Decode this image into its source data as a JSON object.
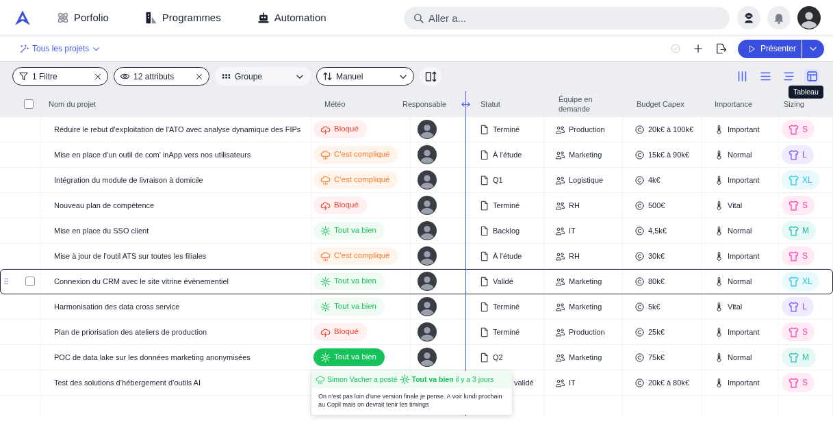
{
  "nav": {
    "items": [
      {
        "label": "Porfolio"
      },
      {
        "label": "Programmes"
      },
      {
        "label": "Automation"
      }
    ],
    "search": {
      "placeholder": "Aller a..."
    }
  },
  "subbar": {
    "scope": "Tous les projets",
    "save_enabled": false,
    "present_button": "Présenter"
  },
  "toolbar": {
    "chips": [
      {
        "kind": "filter",
        "label": "1 Filtre"
      },
      {
        "kind": "attributes",
        "label": "12 attributs"
      },
      {
        "kind": "group",
        "label": "Groupe"
      },
      {
        "kind": "sort",
        "label": "Manuel"
      }
    ],
    "views": [
      {
        "kind": "columns",
        "selected": false
      },
      {
        "kind": "list",
        "selected": false
      },
      {
        "kind": "compact",
        "selected": false
      },
      {
        "kind": "table",
        "selected": true
      }
    ],
    "view_tooltip": "Tableau"
  },
  "table": {
    "select_all": {
      "checked": false
    },
    "columns": [
      "Nom du projet",
      "Météo",
      "Responsable",
      "Statut",
      "Équipe en demande",
      "Budget Capex",
      "Importance",
      "Sizing"
    ],
    "rows": [
      {
        "name": "Réduire le rebut d'exploitation de l'ATO avec analyse dynamique des FIPs",
        "weather": {
          "kind": "blocked",
          "label": "Bloqué",
          "highlighted": false
        },
        "status": "Terminé",
        "status_covered": false,
        "team": "Production",
        "budget": "20k€ à 100k€",
        "importance": "Important",
        "sizing": {
          "label": "S",
          "color": "#ff3ea5"
        },
        "hovered": false
      },
      {
        "name": "Mise en place d'un outil de com' inApp vers nos utilisateurs",
        "weather": {
          "kind": "complicated",
          "label": "C'est compliqué",
          "highlighted": false
        },
        "status": "À l'étude",
        "status_covered": false,
        "team": "Marketing",
        "budget": "15k€ à 90k€",
        "importance": "Normal",
        "sizing": {
          "label": "L",
          "color": "#7b4dff"
        },
        "hovered": false
      },
      {
        "name": "Intégration du module de livraison à domicile",
        "weather": {
          "kind": "complicated",
          "label": "C'est compliqué",
          "highlighted": false
        },
        "status": "Q1",
        "status_covered": false,
        "team": "Logistique",
        "budget": "4k€",
        "importance": "Important",
        "sizing": {
          "label": "XL",
          "color": "#22c6e6"
        },
        "hovered": false
      },
      {
        "name": "Nouveau plan de compétence",
        "weather": {
          "kind": "blocked",
          "label": "Bloqué",
          "highlighted": false
        },
        "status": "Terminé",
        "status_covered": false,
        "team": "RH",
        "budget": "500€",
        "importance": "Vital",
        "sizing": {
          "label": "S",
          "color": "#ff3ea5"
        },
        "hovered": false
      },
      {
        "name": "Mise en place du SSO client",
        "weather": {
          "kind": "good",
          "label": "Tout va bien",
          "highlighted": false
        },
        "status": "Backlog",
        "status_covered": false,
        "team": "IT",
        "budget": "4,5k€",
        "importance": "Normal",
        "sizing": {
          "label": "M",
          "color": "#1fbfa8"
        },
        "hovered": false
      },
      {
        "name": "Mise à jour de l’outil ATS sur toutes les filiales",
        "weather": {
          "kind": "complicated",
          "label": "C'est compliqué",
          "highlighted": false
        },
        "status": "À l'étude",
        "status_covered": false,
        "team": "RH",
        "budget": "30k€",
        "importance": "Important",
        "sizing": {
          "label": "S",
          "color": "#ff3ea5"
        },
        "hovered": false
      },
      {
        "name": "Connexion du CRM avec le site vitrine évènementiel",
        "weather": {
          "kind": "good",
          "label": "Tout va bien",
          "highlighted": false
        },
        "status": "Validé",
        "status_covered": false,
        "team": "Marketing",
        "budget": "80k€",
        "importance": "Normal",
        "sizing": {
          "label": "XL",
          "color": "#22c6e6"
        },
        "hovered": true
      },
      {
        "name": "Harmonisation des data cross service",
        "weather": {
          "kind": "good",
          "label": "Tout va bien",
          "highlighted": false
        },
        "status": "Terminé",
        "status_covered": false,
        "team": "Marketing",
        "budget": "5k€",
        "importance": "Vital",
        "sizing": {
          "label": "L",
          "color": "#7b4dff"
        },
        "hovered": false
      },
      {
        "name": "Plan de priorisation des ateliers de production",
        "weather": {
          "kind": "blocked",
          "label": "Bloqué",
          "highlighted": false
        },
        "status": "Terminé",
        "status_covered": false,
        "team": "Production",
        "budget": "25k€",
        "importance": "Important",
        "sizing": {
          "label": "S",
          "color": "#ff3ea5"
        },
        "hovered": false
      },
      {
        "name": "POC de data lake sur les données marketing anonymisées",
        "weather": {
          "kind": "good",
          "label": "Tout va bien",
          "highlighted": true
        },
        "status": "Q2",
        "status_covered": false,
        "team": "Marketing",
        "budget": "75k€",
        "importance": "Normal",
        "sizing": {
          "label": "M",
          "color": "#1fbfa8"
        },
        "hovered": false
      },
      {
        "name": "Test des solutions d’hébergement d’outils AI",
        "status": "validé",
        "status_covered": true,
        "team": "IT",
        "budget": "20k€ à 80k€",
        "importance": "Important",
        "sizing": {
          "label": "S",
          "color": "#ff3ea5"
        },
        "hovered": false
      }
    ]
  },
  "popover": {
    "author": "Simon Vacher a posté",
    "weather_label": "Tout va bien",
    "time": "il y a 3 jours",
    "message": "On n'est pas loin d'une version finale je pense. A voir lundi prochain au Copil mais on devrait tenir les timings"
  }
}
